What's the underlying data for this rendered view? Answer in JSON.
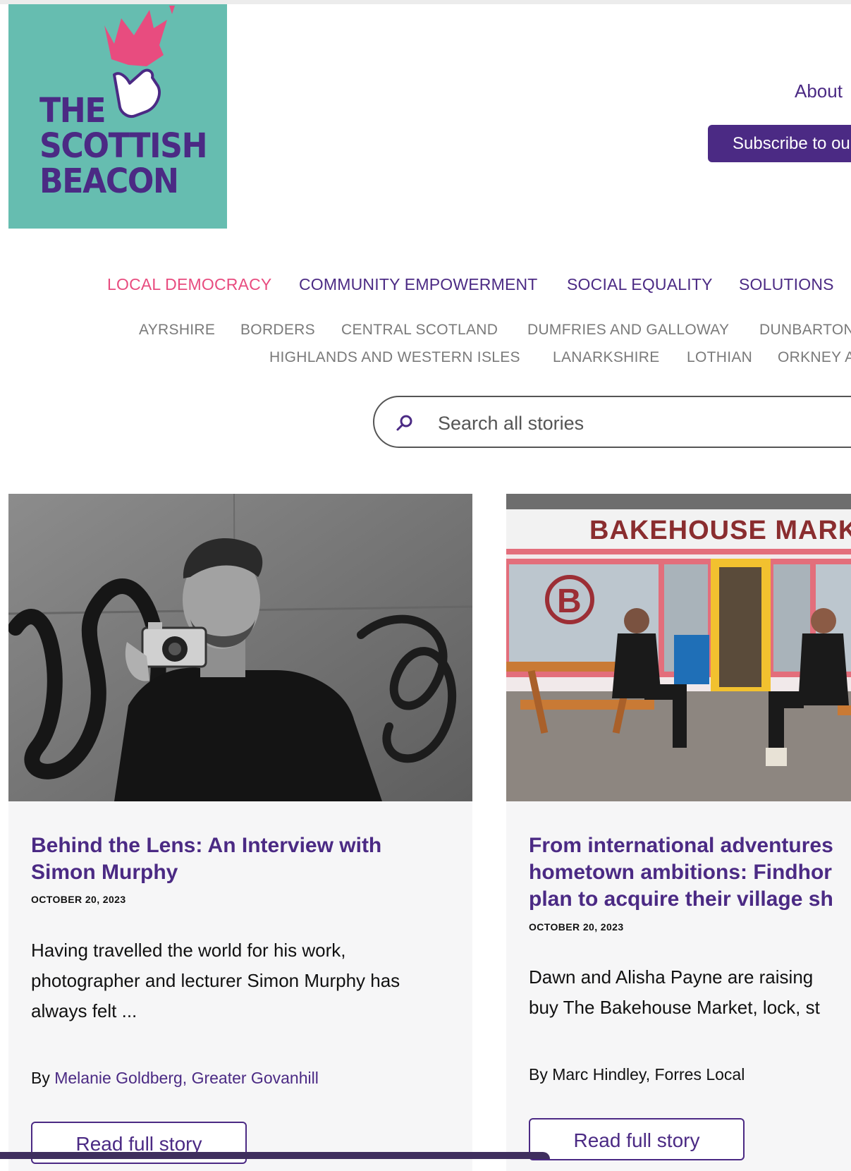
{
  "brand": {
    "logo_line1": "THE",
    "logo_line2": "SCOTTISH",
    "logo_line3": "BEACON",
    "colors": {
      "teal": "#66bdb0",
      "purple": "#4b2a84",
      "pink": "#e84c7f"
    }
  },
  "header": {
    "about_label": "About",
    "subscribe_label": "Subscribe to ou"
  },
  "nav": {
    "main": [
      {
        "label": "LOCAL DEMOCRACY",
        "active": true
      },
      {
        "label": "COMMUNITY EMPOWERMENT",
        "active": false
      },
      {
        "label": "SOCIAL EQUALITY",
        "active": false
      },
      {
        "label": "SOLUTIONS",
        "active": false
      }
    ],
    "regions_row1": [
      "AYRSHIRE",
      "BORDERS",
      "CENTRAL SCOTLAND",
      "DUMFRIES AND GALLOWAY",
      "DUNBARTON"
    ],
    "regions_row2": [
      "HIGHLANDS AND WESTERN ISLES",
      "LANARKSHIRE",
      "LOTHIAN",
      "ORKNEY A"
    ]
  },
  "search": {
    "placeholder": "Search all stories",
    "icon": "search-icon"
  },
  "cards": [
    {
      "title": "Behind the Lens: An Interview with\nSimon Murphy",
      "date": "OCTOBER 20, 2023",
      "excerpt": "Having travelled the world for his work,\nphotographer and lecturer Simon Murphy has\nalways felt ...",
      "by": "By ",
      "author": "Melanie Goldberg, Greater Govanhill",
      "button": "Read full story",
      "image": "black-and-white portrait of man holding camera"
    },
    {
      "title": "From international adventures\nhometown ambitions: Findhor\nplan to acquire their village sh",
      "date": "OCTOBER 20, 2023",
      "excerpt": "Dawn and Alisha Payne are raising \nbuy The Bakehouse Market, lock, st",
      "by": "By Marc Hindley, Forres Local",
      "button": "Read full story",
      "image_sign": "BAKEHOUSE MARK"
    }
  ]
}
